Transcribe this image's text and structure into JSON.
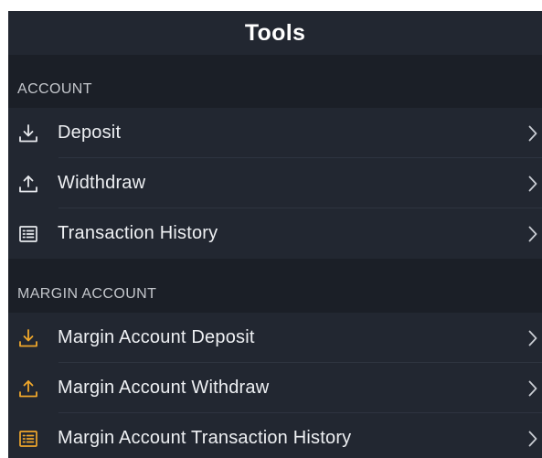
{
  "header": {
    "title": "Tools"
  },
  "sections": [
    {
      "title": "ACCOUNT",
      "items": [
        {
          "label": "Deposit",
          "icon": "deposit-icon",
          "icon_color": "#e8eaee"
        },
        {
          "label": "Widthdraw",
          "icon": "withdraw-icon",
          "icon_color": "#e8eaee"
        },
        {
          "label": "Transaction History",
          "icon": "list-icon",
          "icon_color": "#e8eaee"
        }
      ]
    },
    {
      "title": "MARGIN ACCOUNT",
      "items": [
        {
          "label": "Margin Account Deposit",
          "icon": "deposit-icon",
          "icon_color": "#f0a72b"
        },
        {
          "label": "Margin Account Withdraw",
          "icon": "withdraw-icon",
          "icon_color": "#f0a72b"
        },
        {
          "label": "Margin Account Transaction History",
          "icon": "list-icon",
          "icon_color": "#f0a72b"
        }
      ]
    }
  ],
  "colors": {
    "background": "#1b1f27",
    "row_background": "#222731",
    "accent": "#f0a72b",
    "chevron": "#c9ccd2"
  }
}
